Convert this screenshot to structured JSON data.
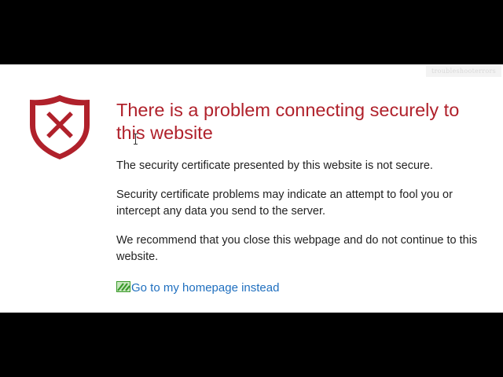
{
  "watermark": {
    "text": "troubleshooterrors"
  },
  "error": {
    "title": "There is a problem connecting securely to this website",
    "paragraphs": [
      "The security certificate presented by this website is not secure.",
      "Security certificate problems may indicate an attempt to fool you or intercept any data you send to the server.",
      "We recommend that you close this webpage and do not continue to this website."
    ],
    "homepage_link": "Go to my homepage instead"
  },
  "icons": {
    "shield": "shield-x-icon",
    "homepage": "green-arrow-icon",
    "cursor": "text-cursor-icon"
  },
  "colors": {
    "title": "#b0212b",
    "shield": "#b0212b",
    "link": "#1f6fbf",
    "body_text": "#222222",
    "link_icon": "#3a9a2a"
  }
}
